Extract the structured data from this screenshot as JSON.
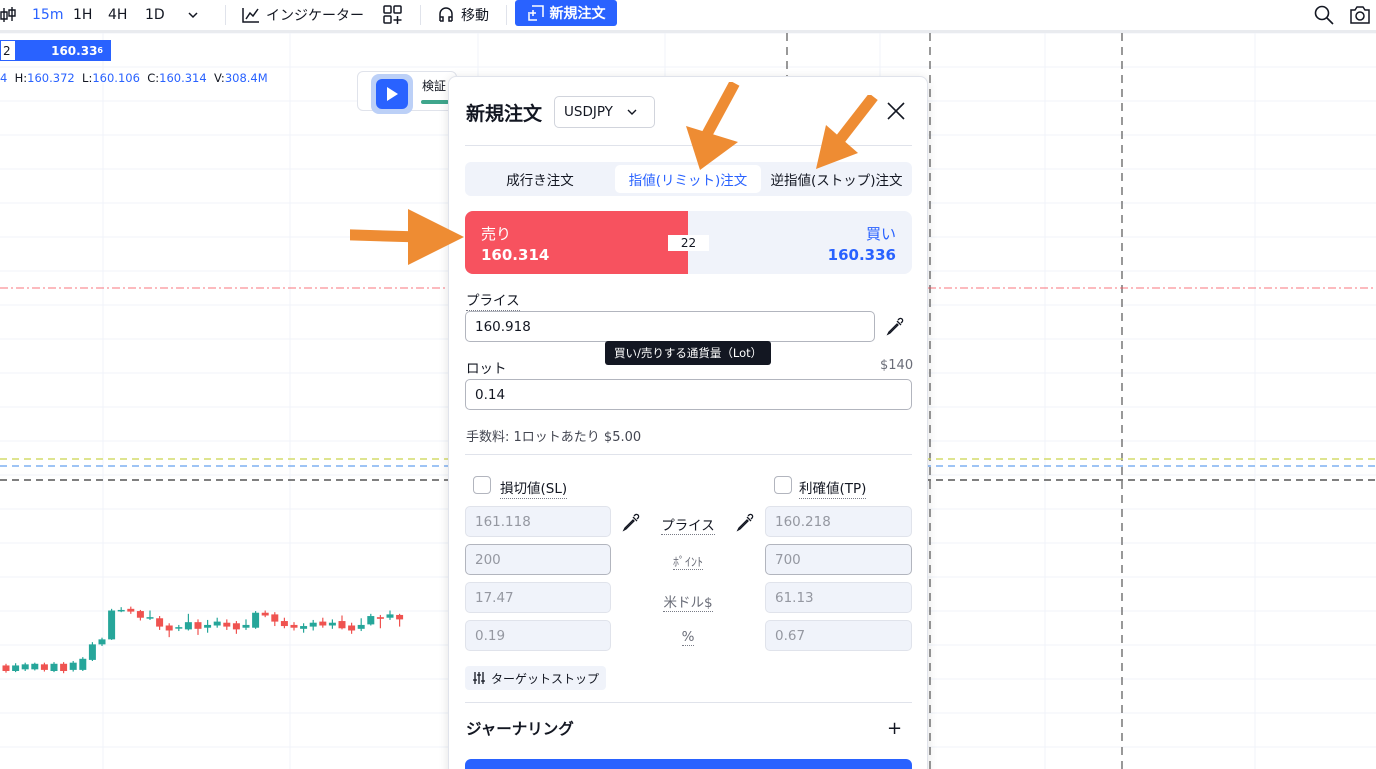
{
  "toolbar": {
    "timeframes": [
      "15m",
      "1H",
      "4H",
      "1D"
    ],
    "active_timeframe": "15m",
    "indicators_label": "インジケーター",
    "move_label": "移動",
    "new_order_label": "新規注文"
  },
  "chart": {
    "price_badge_left": "2",
    "price_badge_value": "160.33",
    "price_badge_sup": "6",
    "ohlc": {
      "o_tail": "4",
      "h_label": "H:",
      "h": "160.372",
      "l_label": "L:",
      "l": "160.106",
      "c_label": "C:",
      "c": "160.314",
      "v_label": "V:",
      "v": "308.4M"
    },
    "replay_label": "検証"
  },
  "chart_data": {
    "type": "candlestick",
    "candles": [
      {
        "o": 1,
        "c": 0,
        "h": 1.3,
        "l": -0.3
      },
      {
        "o": 0,
        "c": 1,
        "h": 1.4,
        "l": -0.2
      },
      {
        "o": 0.3,
        "c": 1.2,
        "h": 1.5,
        "l": 0
      },
      {
        "o": 0.3,
        "c": 1.3,
        "h": 1.5,
        "l": 0.1
      },
      {
        "o": 1.2,
        "c": 0.2,
        "h": 1.5,
        "l": -0.1
      },
      {
        "o": 0,
        "c": 1.3,
        "h": 1.6,
        "l": -0.2
      },
      {
        "o": 1.3,
        "c": 0,
        "h": 1.6,
        "l": -0.4
      },
      {
        "o": 0.2,
        "c": 1.5,
        "h": 1.8,
        "l": -0.1
      },
      {
        "o": 0.2,
        "c": 2.2,
        "h": 2.5,
        "l": 0
      },
      {
        "o": 2,
        "c": 4.8,
        "h": 5.2,
        "l": 1.8
      },
      {
        "o": 4.8,
        "c": 5.7,
        "h": 6.0,
        "l": 4.5
      },
      {
        "o": 5.7,
        "c": 10.9,
        "h": 11.2,
        "l": 5.6
      },
      {
        "o": 10.9,
        "c": 11.0,
        "h": 11.5,
        "l": 10.6
      },
      {
        "o": 11.2,
        "c": 10.7,
        "h": 11.6,
        "l": 10.3
      },
      {
        "o": 10.8,
        "c": 9.6,
        "h": 11.0,
        "l": 9.1
      },
      {
        "o": 9.6,
        "c": 9.7,
        "h": 10.9,
        "l": 9.2
      },
      {
        "o": 9.5,
        "c": 8.0,
        "h": 9.9,
        "l": 7.4
      },
      {
        "o": 8.2,
        "c": 7.3,
        "h": 8.6,
        "l": 6.1
      },
      {
        "o": 7.7,
        "c": 7.9,
        "h": 8.3,
        "l": 7.2
      },
      {
        "o": 7.5,
        "c": 8.8,
        "h": 10.3,
        "l": 7.3
      },
      {
        "o": 8.8,
        "c": 7.6,
        "h": 9.3,
        "l": 6.5
      },
      {
        "o": 7.8,
        "c": 8.3,
        "h": 9.2,
        "l": 6.9
      },
      {
        "o": 8.2,
        "c": 8.9,
        "h": 9.6,
        "l": 7.8
      },
      {
        "o": 8.7,
        "c": 8.0,
        "h": 9.3,
        "l": 7.4
      },
      {
        "o": 8.6,
        "c": 7.5,
        "h": 9.0,
        "l": 6.7
      },
      {
        "o": 7.8,
        "c": 8.3,
        "h": 9.3,
        "l": 7.4
      },
      {
        "o": 7.8,
        "c": 10.5,
        "h": 10.8,
        "l": 7.6
      },
      {
        "o": 10.5,
        "c": 10.0,
        "h": 10.9,
        "l": 9.7
      },
      {
        "o": 10.2,
        "c": 8.9,
        "h": 10.6,
        "l": 8.1
      },
      {
        "o": 9.0,
        "c": 8.1,
        "h": 9.6,
        "l": 7.7
      },
      {
        "o": 8.3,
        "c": 7.8,
        "h": 8.8,
        "l": 7.3
      },
      {
        "o": 7.6,
        "c": 8.1,
        "h": 8.6,
        "l": 6.9
      },
      {
        "o": 8.0,
        "c": 8.7,
        "h": 9.2,
        "l": 7.3
      },
      {
        "o": 8.9,
        "c": 8.2,
        "h": 9.6,
        "l": 7.8
      },
      {
        "o": 8.2,
        "c": 8.7,
        "h": 9.3,
        "l": 7.6
      },
      {
        "o": 9.0,
        "c": 7.7,
        "h": 10.0,
        "l": 7.5
      },
      {
        "o": 8.2,
        "c": 7.3,
        "h": 8.7,
        "l": 6.7
      },
      {
        "o": 7.6,
        "c": 8.3,
        "h": 9.5,
        "l": 7.2
      },
      {
        "o": 8.4,
        "c": 9.9,
        "h": 10.3,
        "l": 8.2
      },
      {
        "o": 9.7,
        "c": 9.4,
        "h": 10.1,
        "l": 7.7
      },
      {
        "o": 9.6,
        "c": 10.2,
        "h": 10.9,
        "l": 9.2
      },
      {
        "o": 10.1,
        "c": 9.3,
        "h": 10.3,
        "l": 8.0
      }
    ],
    "up_color": "#26a69a",
    "down_color": "#ef5350"
  },
  "order_panel": {
    "title": "新規注文",
    "symbol": "USDJPY",
    "tabs": [
      "成行き注文",
      "指値(リミット)注文",
      "逆指値(ストップ)注文"
    ],
    "selected_tab": "指値(リミット)注文",
    "sell_label": "売り",
    "sell_price": "160.314",
    "buy_label": "買い",
    "buy_price": "160.336",
    "spread": "22",
    "price_label": "プライス",
    "price_value": "160.918",
    "tooltip": "買い/売りする通貨量（Lot）",
    "lot_label": "ロット",
    "lot_amount": "$140",
    "lot_value": "0.14",
    "fee_label": "手数料:",
    "fee_value": "1ロットあたり $5.00",
    "sl_label": "損切値(SL)",
    "tp_label": "利確値(TP)",
    "row_labels": [
      "プライス",
      "ﾎﾟｲﾝﾄ",
      "米ドル$",
      "%"
    ],
    "sl_values": [
      "161.118",
      "200",
      "17.47",
      "0.19"
    ],
    "tp_values": [
      "160.218",
      "700",
      "61.13",
      "0.67"
    ],
    "target_stop_label": "ターゲットストップ",
    "journal_label": "ジャーナリング",
    "plus": "+"
  },
  "colors": {
    "accent": "#2962ff",
    "sell": "#f7525f",
    "annotation_arrow": "#ee8c33"
  },
  "icons": [
    "chart-type-icon",
    "chevron-down-icon",
    "indicators-icon",
    "templates-icon",
    "move-icon",
    "add-order-icon",
    "search-icon",
    "camera-icon",
    "play-icon",
    "close-icon",
    "pipette-icon",
    "sliders-icon"
  ]
}
